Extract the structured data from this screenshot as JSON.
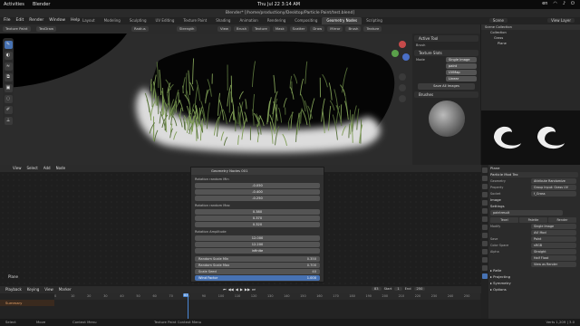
{
  "os": {
    "activities": "Activities",
    "app": "Blender",
    "clock": "Thu Jul 22  3:14 AM",
    "indicators": [
      "en",
      "wifi",
      "vol",
      "power"
    ]
  },
  "window_title": "Blender* [/home/productiony/Desktop/Particle Paint/test.blend]",
  "menus": [
    "File",
    "Edit",
    "Render",
    "Window",
    "Help"
  ],
  "workspaces": [
    "Layout",
    "Modeling",
    "Sculpting",
    "UV Editing",
    "Texture Paint",
    "Shading",
    "Animation",
    "Rendering",
    "Compositing",
    "Geometry Nodes",
    "Scripting"
  ],
  "active_workspace": "Geometry Nodes",
  "scene": "Scene",
  "view_layer": "View Layer",
  "viewport_header": {
    "mode": "Texture Paint",
    "items": [
      "View",
      "Brush",
      "Texture",
      "Mask",
      "Scatter",
      "Draw",
      "Mirror",
      "Brush",
      "Texture"
    ],
    "brush": "TexDraw",
    "radius": "Radius",
    "strength": "Strength"
  },
  "tools": [
    "brush",
    "blur",
    "smear",
    "clone",
    "fill",
    "mask",
    "annotate",
    "measure"
  ],
  "npanel": {
    "active_tool": "Active Tool",
    "brush": "Brush",
    "texture_slots": "Texture Slots",
    "mode": "Mode",
    "mode_value": "Single Image",
    "image": "paint",
    "uv": "UVMap",
    "interp": "Linear",
    "save_button": "Save All Images",
    "brushes": "Brushes"
  },
  "outliner": {
    "title": "Scene Collection",
    "items": [
      "Collection",
      "Grass",
      "Plane"
    ]
  },
  "node_editor": {
    "menus": [
      "View",
      "Select",
      "Add",
      "Node"
    ],
    "panel_title": "Geometry Nodes 001",
    "rotation_min_label": "Rotation random Min",
    "rotation_min": [
      "-0.050",
      "-0.400",
      "-0.250"
    ],
    "rotation_max_label": "Rotation random Max",
    "rotation_max": [
      "0.380",
      "0.370",
      "0.320"
    ],
    "rotation_amp_label": "Rotation Amplitude",
    "rotation_amp": [
      "12.000",
      "12.200",
      "infinite"
    ],
    "sockets": [
      {
        "label": "Random Scale Min",
        "value": "0.350"
      },
      {
        "label": "Random Scale Max",
        "value": "0.700"
      },
      {
        "label": "Scale Seed",
        "value": "40"
      },
      {
        "label": "Wind Factor",
        "value": "1.000"
      }
    ],
    "object_name": "Plane"
  },
  "properties": {
    "object_label": "Plane",
    "modifier": "Particle Mod Tex",
    "geometry_label": "Geometry",
    "geometry_value": "Attribute Randomize",
    "property_label": "Property",
    "property_value": "Group Input: Grass UV",
    "socket_label": "Socket",
    "socket_value": "f_Grass",
    "image_section": "Image",
    "settings_section": "Settings",
    "image_name": "paintresult",
    "tabs": [
      "Texel",
      "Palette",
      "Render"
    ],
    "rows": [
      {
        "label": "Modify",
        "value": "Single Image"
      },
      {
        "label": "",
        "value": "AVI Mod"
      },
      {
        "label": "Save",
        "value": "Paint"
      },
      {
        "label": "Color Space",
        "value": "sRGB"
      },
      {
        "label": "Alpha",
        "value": "Straight"
      },
      {
        "label": "",
        "value": "Half Float"
      },
      {
        "label": "",
        "value": "View as Render"
      }
    ],
    "sections": [
      "Relie",
      "Projecting",
      "Symmetry",
      "Options"
    ]
  },
  "timeline": {
    "menus": [
      "Playback",
      "Keying",
      "View",
      "Marker"
    ],
    "summary": "Summary",
    "current_frame": "83",
    "start_label": "Start",
    "start": "1",
    "end_label": "End",
    "end": "250",
    "ticks": [
      "0",
      "10",
      "20",
      "30",
      "40",
      "50",
      "60",
      "70",
      "80",
      "90",
      "100",
      "110",
      "120",
      "130",
      "140",
      "150",
      "160",
      "170",
      "180",
      "190",
      "200",
      "210",
      "220",
      "230",
      "240",
      "250"
    ]
  },
  "status": {
    "left": "Select",
    "mid1": "Move",
    "mid2": "Context Menu",
    "mid3": "Texture Paint Context Menu",
    "right": "Verts 1,209 | 3.0"
  }
}
